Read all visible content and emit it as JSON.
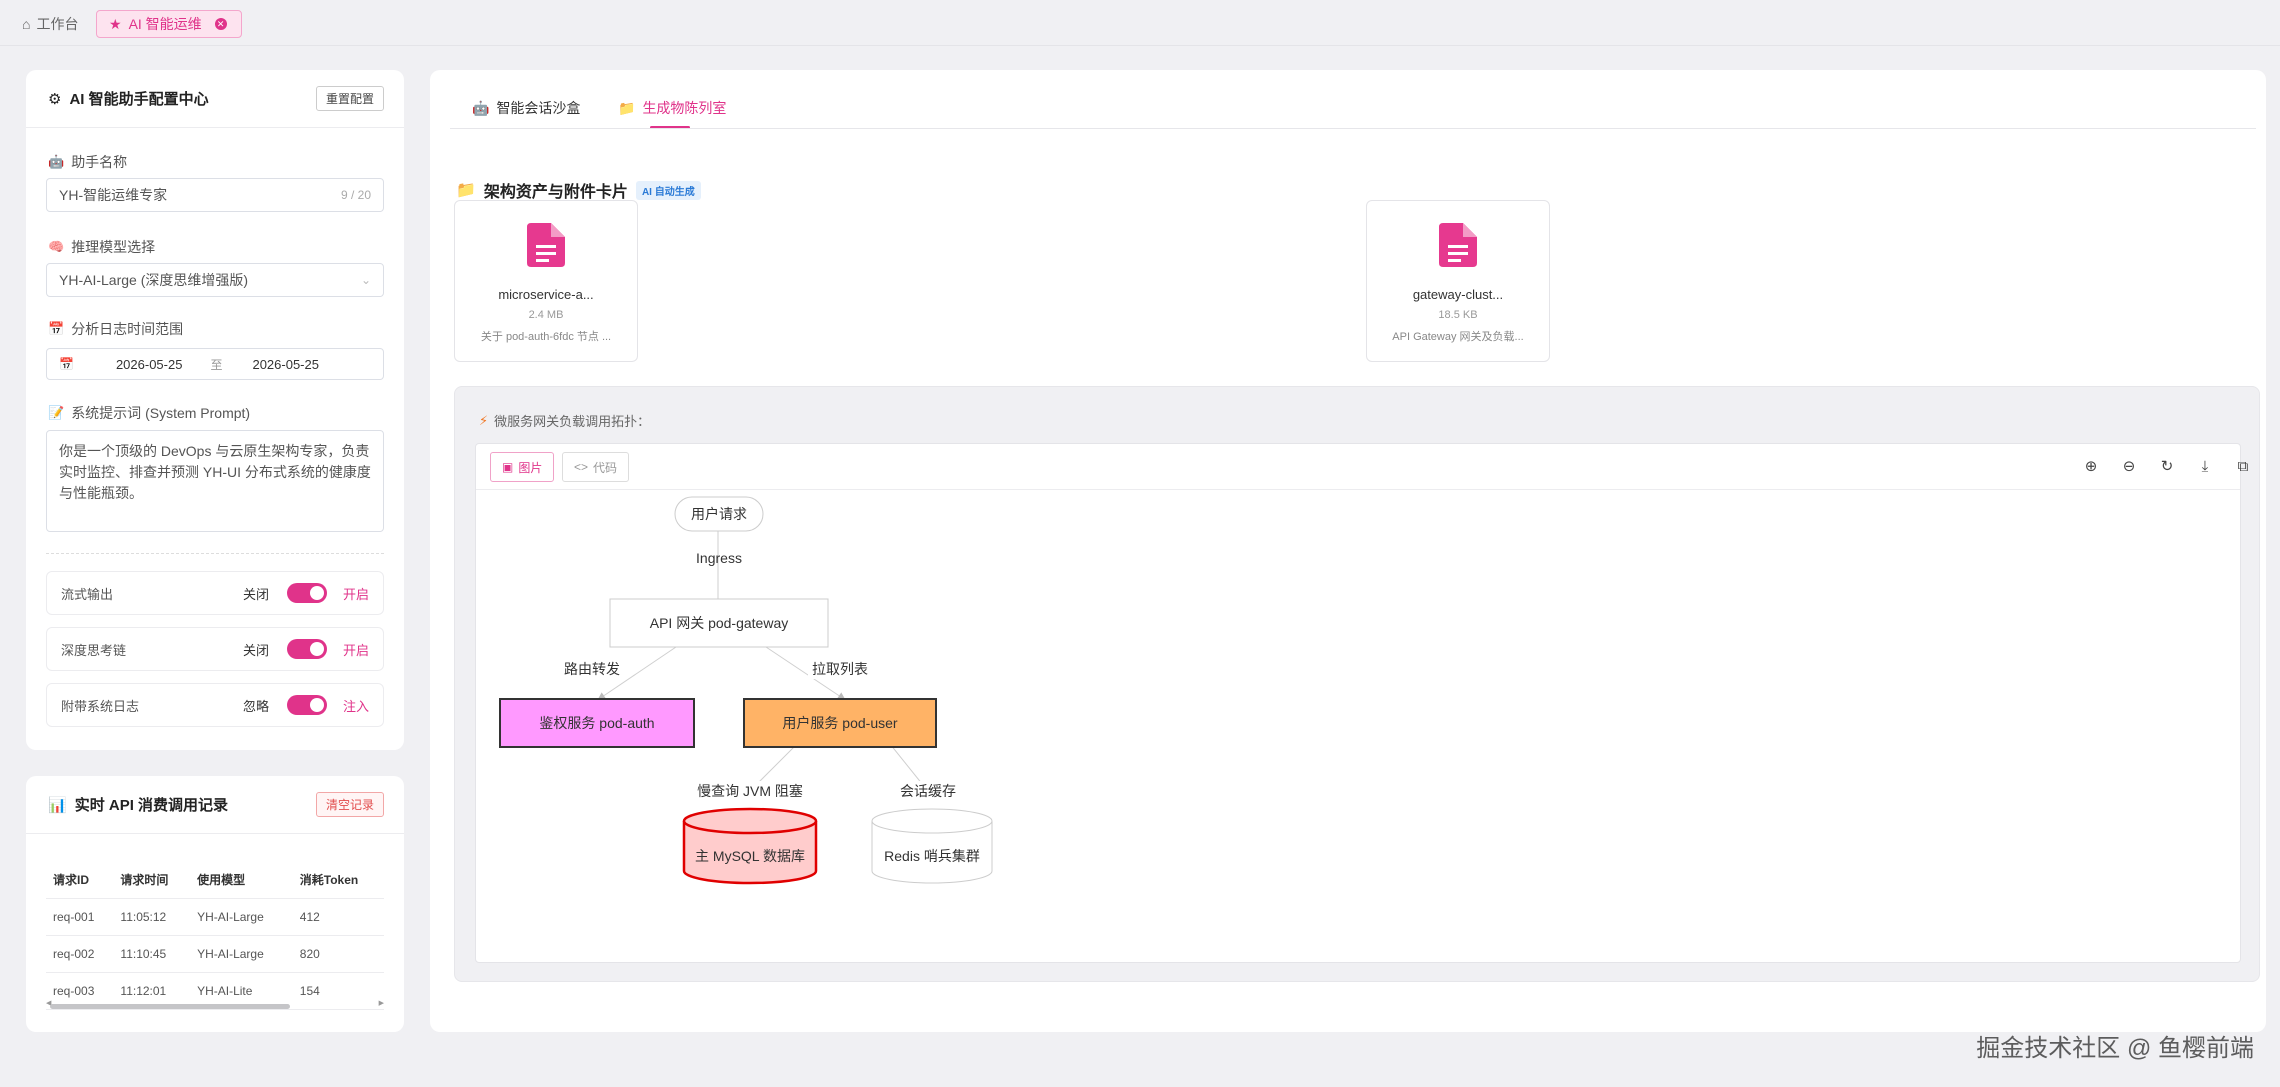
{
  "topbar": {
    "home_label": "工作台",
    "active_tab_label": "AI 智能运维"
  },
  "config": {
    "title": "AI 智能助手配置中心",
    "reset_label": "重置配置",
    "name_label": "助手名称",
    "name_value": "YH-智能运维专家",
    "name_counter": "9 / 20",
    "model_label": "推理模型选择",
    "model_value": "YH-AI-Large (深度思维增强版)",
    "range_label": "分析日志时间范围",
    "range_start": "2026-05-25",
    "range_sep": "至",
    "range_end": "2026-05-25",
    "prompt_label": "系统提示词 (System Prompt)",
    "prompt_value": "你是一个顶级的 DevOps 与云原生架构专家，负责实时监控、排查并预测 YH-UI 分布式系统的健康度与性能瓶颈。",
    "switches": [
      {
        "label": "流式输出",
        "off": "关闭",
        "on": "开启"
      },
      {
        "label": "深度思考链",
        "off": "关闭",
        "on": "开启"
      },
      {
        "label": "附带系统日志",
        "off": "忽略",
        "on": "注入"
      }
    ]
  },
  "api_log": {
    "title": "实时 API 消费调用记录",
    "clear_label": "清空记录",
    "columns": [
      "请求ID",
      "请求时间",
      "使用模型",
      "消耗Token"
    ],
    "rows": [
      [
        "req-001",
        "11:05:12",
        "YH-AI-Large",
        "412"
      ],
      [
        "req-002",
        "11:10:45",
        "YH-AI-Large",
        "820"
      ],
      [
        "req-003",
        "11:12:01",
        "YH-AI-Lite",
        "154"
      ]
    ]
  },
  "right": {
    "tabs": [
      "智能会话沙盒",
      "生成物陈列室"
    ],
    "section_title": "架构资产与附件卡片",
    "section_badge": "AI 自动生成",
    "files": [
      {
        "name": "microservice-a...",
        "size": "2.4 MB",
        "desc": "关于 pod-auth-6fdc 节点 ..."
      },
      {
        "name": "gateway-clust...",
        "size": "18.5 KB",
        "desc": "API Gateway 网关及负载..."
      }
    ],
    "diagram_title": "微服务网关负载调用拓扑：",
    "view_image_label": "图片",
    "view_code_label": "代码"
  },
  "diagram": {
    "nodes": {
      "request": "用户请求",
      "gateway": "API 网关 pod-gateway",
      "auth": "鉴权服务 pod-auth",
      "user": "用户服务 pod-user",
      "mysql": "主 MySQL 数据库",
      "redis": "Redis 哨兵集群"
    },
    "edges": {
      "ingress": "Ingress",
      "route": "路由转发",
      "pull": "拉取列表",
      "slow": "慢查询 JVM 阻塞",
      "session": "会话缓存"
    },
    "colors": {
      "auth_fill": "#ff99ff",
      "user_fill": "#ffb366",
      "mysql_fill": "#ffcccc",
      "mysql_stroke": "#e00000"
    }
  },
  "watermark": "掘金技术社区 @ 鱼樱前端"
}
